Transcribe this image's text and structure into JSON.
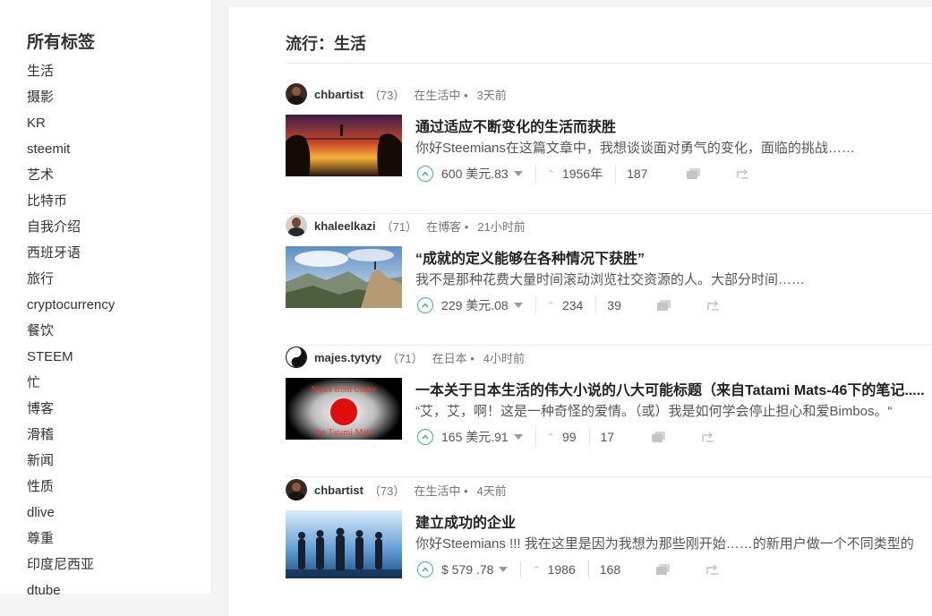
{
  "sidebar": {
    "title": "所有标签",
    "tags": [
      "生活",
      "摄影",
      "KR",
      "steemit",
      "艺术",
      "比特币",
      "自我介绍",
      "西班牙语",
      "旅行",
      "cryptocurrency",
      "餐饮",
      "STEEM",
      "忙",
      "博客",
      "滑稽",
      "新闻",
      "性质",
      "dlive",
      "尊重",
      "印度尼西亚",
      "dtube"
    ]
  },
  "main": {
    "title": "流行：生活",
    "posts": [
      {
        "author": "chbartist",
        "rep": "（73）",
        "category": "在生活中 •",
        "time": "3天前",
        "title": "通过适应不断变化的生活而获胜",
        "summary": "你好Steemians在这篇文章中，我想谈谈面对勇气的变化，面临的挑战……",
        "payout": "600 美元.83",
        "votes": "1956年",
        "responses": "187"
      },
      {
        "author": "khaleelkazi",
        "rep": "（71）",
        "category": "在博客 •",
        "time": "21小时前",
        "title": "“成就的定义能够在各种情况下获胜”",
        "summary": "我不是那种花费大量时间滚动浏览社交资源的人。大部分时间……",
        "payout": "229 美元.08",
        "votes": "234",
        "responses": "39"
      },
      {
        "author": "majes.tytyty",
        "rep": "（71）",
        "category": "在日本 •",
        "time": "4小时前",
        "title": "一本关于日本生活的伟大小说的八大可能标题（来自Tatami Mats-46下的笔记.....",
        "summary": "“艾，艾，啊！这是一种奇怪的爱情。（或）我是如何学会停止担心和爱Bimbos。“",
        "payout": "165 美元.91",
        "votes": "99",
        "responses": "17",
        "thumb_text_top": "Notes from Under",
        "thumb_text_bottom": "the Tatami Mats"
      },
      {
        "author": "chbartist",
        "rep": "（73）",
        "category": "在生活中 •",
        "time": "4天前",
        "title": "建立成功的企业",
        "summary": "你好Steemians !!! 我在这里是因为我想为那些刚开始……的新用户做一个不同类型的",
        "payout": "$ 579 .78",
        "votes": "1986",
        "responses": "168"
      }
    ]
  },
  "colors": {
    "accent": "#3cb68a",
    "text": "#333333",
    "muted": "#777777"
  }
}
